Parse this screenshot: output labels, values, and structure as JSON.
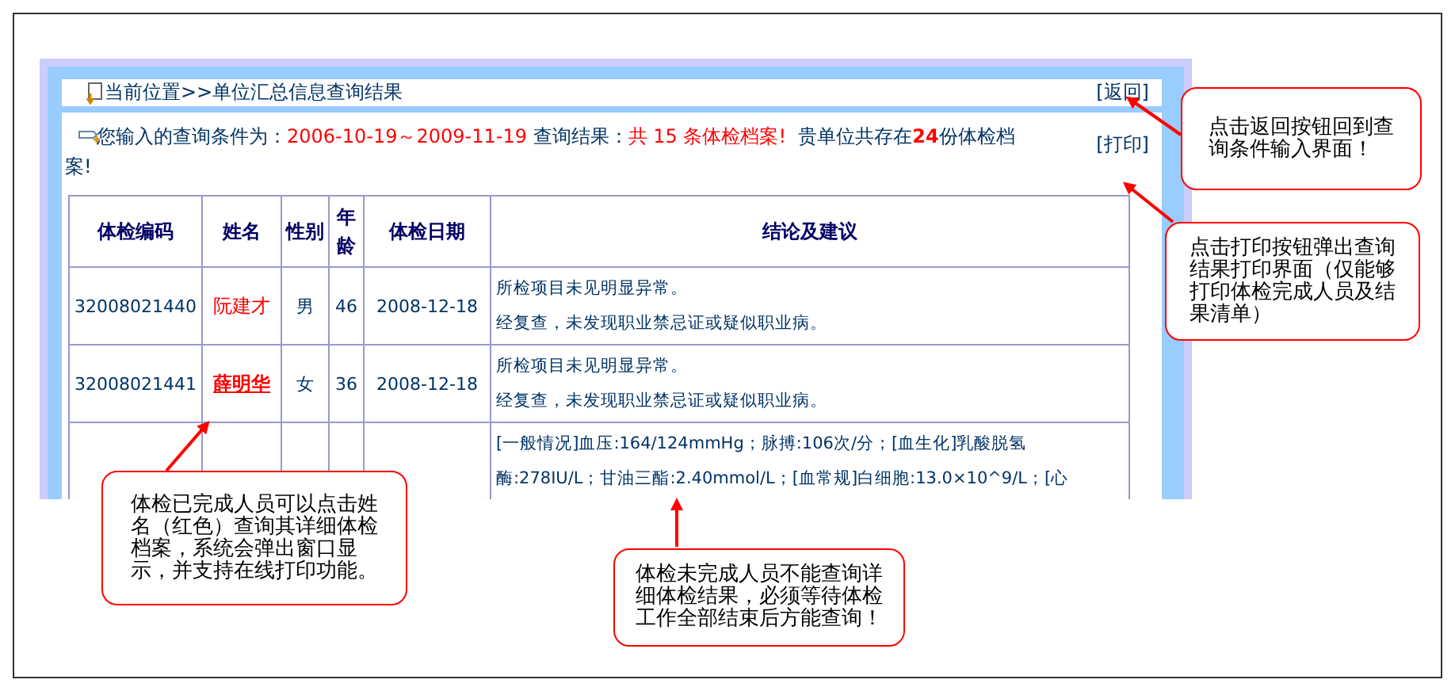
{
  "breadcrumb": {
    "label": "当前位置>>单位汇总信息查询结果",
    "back_link": "[返回]"
  },
  "query": {
    "prefix": "您输入的查询条件为：",
    "range": "2006-10-19～2009-11-19",
    "result_label": " 查询结果：",
    "result": "共 15 条体检档案!",
    "unit_prefix": "  贵单位共存在",
    "unit_count": "24",
    "unit_suffix": "份体检档案!",
    "print_link": "[打印]"
  },
  "table": {
    "columns": [
      "体检编码",
      "姓名",
      "性别",
      "年龄",
      "体检日期",
      "结论及建议"
    ],
    "rows": [
      {
        "code": "32008021440",
        "name": "阮建才",
        "hovered": false,
        "gender": "男",
        "age": "46",
        "date": "2008-12-18",
        "conclusion": [
          "所检项目未见明显异常。",
          "经复查，未发现职业禁忌证或疑似职业病。"
        ]
      },
      {
        "code": "32008021441",
        "name": "薛明华",
        "hovered": true,
        "gender": "女",
        "age": "36",
        "date": "2008-12-18",
        "conclusion": [
          "所检项目未见明显异常。",
          "经复查，未发现职业禁忌证或疑似职业病。"
        ]
      },
      {
        "conclusion": [
          "[一般情况]血压:164/124mmHg；脉搏:106次/分；[血生化]乳酸脱氢",
          "酶:278IU/L；甘油三酯:2.40mmol/L；[血常规]白细胞:13.0×10^9/L；[心"
        ]
      }
    ]
  },
  "callouts": [
    {
      "text": "点击返回按钮回到查询条件输入界面！"
    },
    {
      "text": "点击打印按钮弹出查询结果打印界面（仅能够打印体检完成人员及结果清单）"
    },
    {
      "text": "体检已完成人员可以点击姓名（红色）查询其详细体检档案，系统会弹出窗口显示，并支持在线打印功能。"
    },
    {
      "text": "体检未完成人员不能查询详细体检结果，必须等待体检工作全部结束后方能查询！"
    }
  ]
}
